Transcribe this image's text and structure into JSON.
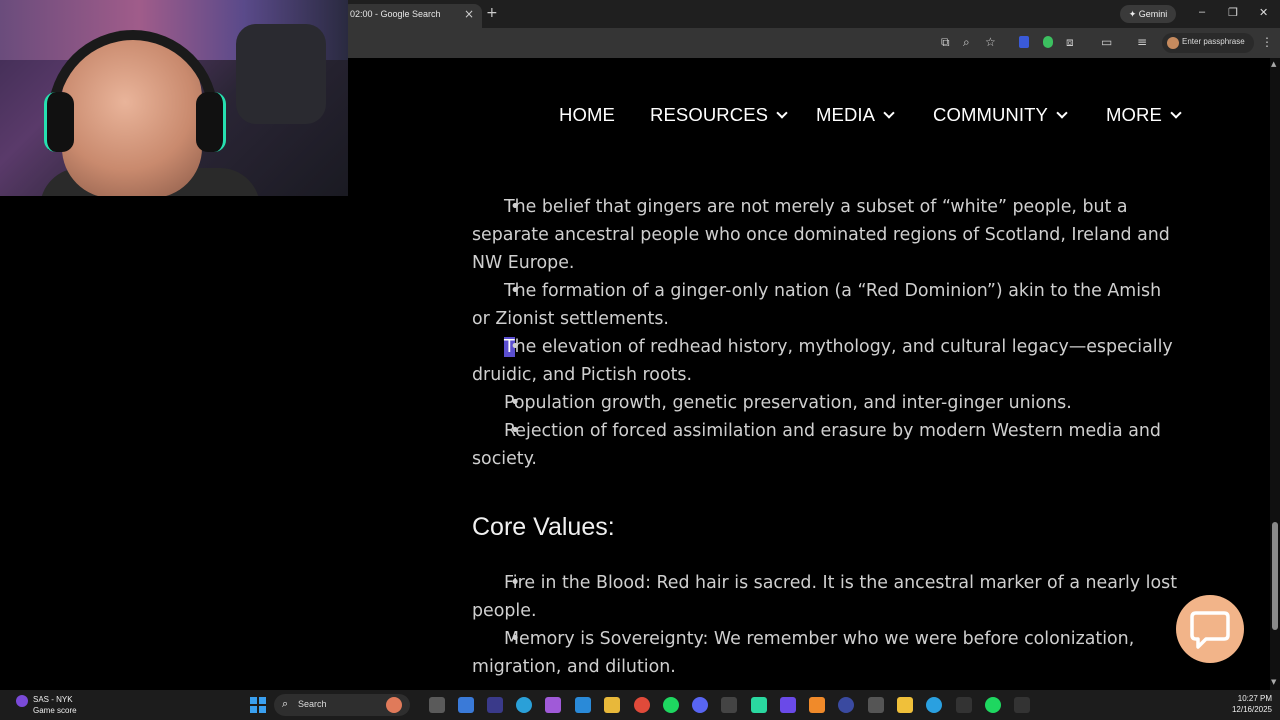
{
  "browser": {
    "tab_title": "02:00 - Google Search",
    "tab_close": "×",
    "new_tab": "+",
    "gemini_label": "✦ Gemini",
    "window_controls": [
      "–",
      "❐",
      "✕"
    ],
    "profile_text": "Enter passphrase"
  },
  "nav": {
    "items": [
      "HOME",
      "RESOURCES",
      "MEDIA",
      "COMMUNITY",
      "MORE"
    ]
  },
  "content": {
    "bullets_1": [
      "The belief that gingers are not merely a subset of “white” people, but a separate ancestral people who once dominated regions of Scotland, Ireland and NW Europe.",
      "The formation of a ginger-only nation (a “Red Dominion”) akin to the Amish or Zionist settlements.",
      "The elevation of redhead history, mythology, and cultural legacy—especially druidic, and Pictish roots.",
      "Population growth, genetic preservation, and inter-ginger unions.",
      "Rejection of forced assimilation and erasure by modern Western media and society."
    ],
    "highlight_char": "T",
    "bullet3_rest": "he elevation of redhead history, mythology, and cultural legacy—especially druidic, and Pictish roots.",
    "heading": "Core Values:",
    "bullets_2": [
      "Fire in the Blood: Red hair is sacred. It is the ancestral marker of a nearly lost people.",
      "Memory is Sovereignty: We remember who we were before colonization, migration, and dilution."
    ],
    "bullet_char": "•"
  },
  "taskbar": {
    "game_title": "SAS - NYK",
    "game_sub": "Game score",
    "search_label": "Search",
    "time": "10:27 PM",
    "date": "12/16/2025"
  },
  "colors": {
    "highlight": "#5b4fd0",
    "chat_bubble": "#f2b489",
    "page_bg": "#000000"
  },
  "icons": [
    "search-icon",
    "chat-icon",
    "windows-icon",
    "chevron-down-icon",
    "zoom-icon",
    "star-icon",
    "extensions-icon"
  ]
}
